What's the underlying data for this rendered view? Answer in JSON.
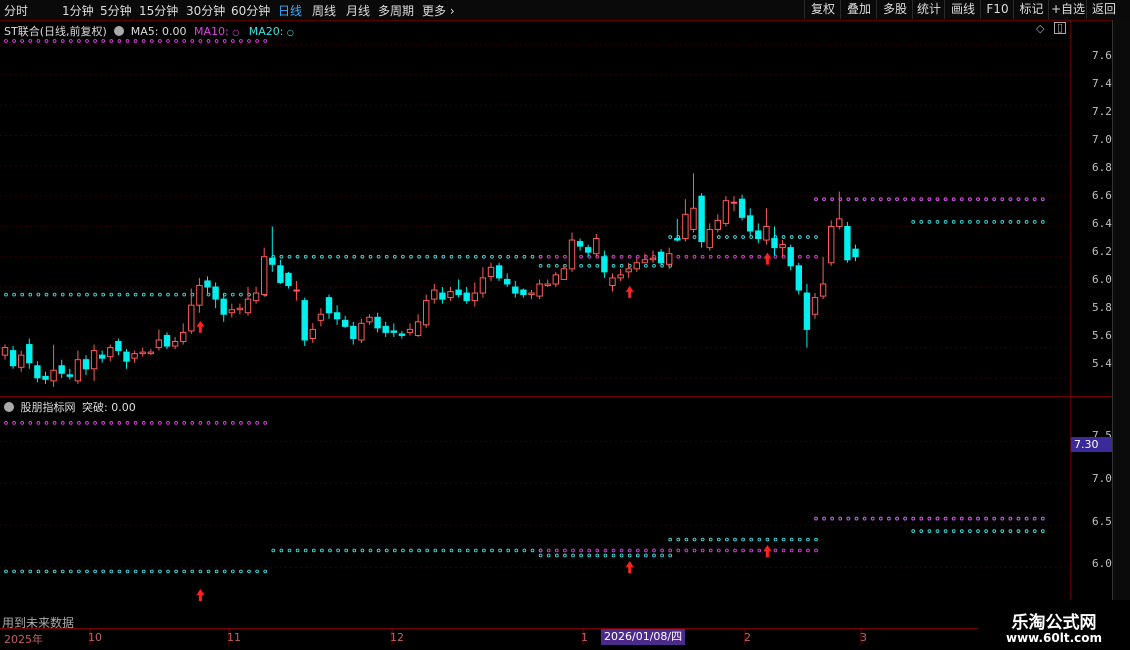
{
  "toolbar": {
    "periods": [
      "分时",
      "1分钟",
      "5分钟",
      "15分钟",
      "30分钟",
      "60分钟",
      "日线",
      "周线",
      "月线",
      "多周期",
      "更多"
    ],
    "active_period": "日线",
    "right_buttons": [
      "复权",
      "叠加",
      "多股",
      "统计",
      "画线",
      "F10",
      "标记",
      "+自选",
      "返回"
    ]
  },
  "main_panel": {
    "title": "ST联合(日线,前复权)",
    "ma5": "MA5: 0.00",
    "ma10": "MA10:",
    "ma20": "MA20:",
    "price_axis": [
      "7.60",
      "7.40",
      "7.20",
      "7.00",
      "6.80",
      "6.60",
      "6.40",
      "6.20",
      "6.00",
      "5.80",
      "5.60",
      "5.40"
    ]
  },
  "sub_panel": {
    "title": "股朋指标网",
    "value": "突破: 0.00",
    "axis": [
      "7.50",
      "7.00",
      "6.50",
      "6.00"
    ],
    "price_tag": "7.30",
    "note": "用到未来数据"
  },
  "x_axis": {
    "labels": [
      "2025年",
      "10",
      "11",
      "12",
      "1",
      "2",
      "3"
    ],
    "cursor_date": "2026/01/08/四"
  },
  "watermark": {
    "line1": "乐淘公式网",
    "line2": "www.60lt.com"
  },
  "colors": {
    "up": "#ff5a5a",
    "down": "#00f0f0",
    "magenta": "#e040e0",
    "cyan_dot": "#40e0e0",
    "arrow": "#ff2020",
    "grid": "#3a0000"
  },
  "chart_data": {
    "type": "candlestick",
    "price_axis_ylim": [
      5.3,
      7.75
    ],
    "bars": [
      [
        5.55,
        5.6,
        5.62,
        5.52
      ],
      [
        5.58,
        5.48,
        5.61,
        5.46
      ],
      [
        5.47,
        5.55,
        5.58,
        5.44
      ],
      [
        5.62,
        5.5,
        5.66,
        5.46
      ],
      [
        5.48,
        5.4,
        5.51,
        5.37
      ],
      [
        5.41,
        5.39,
        5.44,
        5.36
      ],
      [
        5.38,
        5.45,
        5.62,
        5.34
      ],
      [
        5.48,
        5.43,
        5.52,
        5.4
      ],
      [
        5.42,
        5.41,
        5.46,
        5.39
      ],
      [
        5.38,
        5.52,
        5.58,
        5.36
      ],
      [
        5.52,
        5.46,
        5.55,
        5.42
      ],
      [
        5.46,
        5.58,
        5.62,
        5.38
      ],
      [
        5.55,
        5.53,
        5.58,
        5.5
      ],
      [
        5.54,
        5.6,
        5.62,
        5.51
      ],
      [
        5.64,
        5.58,
        5.66,
        5.55
      ],
      [
        5.57,
        5.51,
        5.59,
        5.46
      ],
      [
        5.53,
        5.56,
        5.58,
        5.5
      ],
      [
        5.56,
        5.57,
        5.6,
        5.54
      ],
      [
        5.56,
        5.57,
        5.59,
        5.55
      ],
      [
        5.6,
        5.65,
        5.72,
        5.58
      ],
      [
        5.68,
        5.61,
        5.7,
        5.59
      ],
      [
        5.61,
        5.64,
        5.67,
        5.59
      ],
      [
        5.64,
        5.7,
        5.76,
        5.62
      ],
      [
        5.71,
        5.88,
        5.99,
        5.69
      ],
      [
        5.88,
        6.01,
        6.06,
        5.83
      ],
      [
        6.04,
        6.0,
        6.07,
        5.96
      ],
      [
        6.0,
        5.92,
        6.03,
        5.86
      ],
      [
        5.92,
        5.82,
        5.96,
        5.77
      ],
      [
        5.83,
        5.85,
        5.89,
        5.8
      ],
      [
        5.85,
        5.86,
        5.89,
        5.82
      ],
      [
        5.83,
        5.92,
        6.0,
        5.81
      ],
      [
        5.91,
        5.96,
        6.0,
        5.89
      ],
      [
        5.95,
        6.2,
        6.26,
        5.94
      ],
      [
        6.19,
        6.15,
        6.4,
        6.1
      ],
      [
        6.14,
        6.03,
        6.18,
        6.02
      ],
      [
        6.09,
        6.01,
        6.1,
        5.99
      ],
      [
        5.98,
        5.98,
        6.04,
        5.91
      ],
      [
        5.91,
        5.65,
        5.93,
        5.61
      ],
      [
        5.66,
        5.72,
        5.76,
        5.63
      ],
      [
        5.78,
        5.82,
        5.86,
        5.74
      ],
      [
        5.93,
        5.83,
        5.95,
        5.79
      ],
      [
        5.83,
        5.79,
        5.88,
        5.75
      ],
      [
        5.78,
        5.74,
        5.81,
        5.73
      ],
      [
        5.74,
        5.66,
        5.77,
        5.62
      ],
      [
        5.65,
        5.76,
        5.79,
        5.63
      ],
      [
        5.77,
        5.8,
        5.82,
        5.75
      ],
      [
        5.8,
        5.73,
        5.83,
        5.7
      ],
      [
        5.74,
        5.7,
        5.77,
        5.67
      ],
      [
        5.71,
        5.7,
        5.76,
        5.67
      ],
      [
        5.69,
        5.68,
        5.71,
        5.66
      ],
      [
        5.7,
        5.72,
        5.76,
        5.68
      ],
      [
        5.68,
        5.77,
        5.82,
        5.67
      ],
      [
        5.75,
        5.91,
        5.95,
        5.73
      ],
      [
        5.92,
        5.98,
        6.02,
        5.89
      ],
      [
        5.96,
        5.92,
        6.0,
        5.89
      ],
      [
        5.93,
        5.97,
        6.0,
        5.91
      ],
      [
        5.98,
        5.95,
        6.05,
        5.93
      ],
      [
        5.96,
        5.91,
        6.0,
        5.89
      ],
      [
        5.91,
        5.96,
        6.03,
        5.87
      ],
      [
        5.96,
        6.06,
        6.13,
        5.93
      ],
      [
        6.07,
        6.13,
        6.16,
        6.04
      ],
      [
        6.14,
        6.06,
        6.16,
        6.04
      ],
      [
        6.05,
        6.02,
        6.09,
        6.0
      ],
      [
        6.0,
        5.96,
        6.04,
        5.93
      ],
      [
        5.98,
        5.95,
        5.99,
        5.93
      ],
      [
        5.95,
        5.96,
        5.98,
        5.92
      ],
      [
        5.94,
        6.02,
        6.05,
        5.92
      ],
      [
        6.01,
        6.02,
        6.05,
        6.0
      ],
      [
        6.02,
        6.08,
        6.1,
        6.0
      ],
      [
        6.05,
        6.12,
        6.15,
        6.05
      ],
      [
        6.12,
        6.31,
        6.36,
        6.1
      ],
      [
        6.3,
        6.27,
        6.32,
        6.24
      ],
      [
        6.26,
        6.23,
        6.28,
        6.2
      ],
      [
        6.22,
        6.32,
        6.35,
        6.2
      ],
      [
        6.2,
        6.1,
        6.24,
        6.06
      ],
      [
        6.01,
        6.06,
        6.09,
        5.97
      ],
      [
        6.06,
        6.08,
        6.12,
        6.04
      ],
      [
        6.1,
        6.12,
        6.16,
        6.06
      ],
      [
        6.12,
        6.16,
        6.19,
        6.1
      ],
      [
        6.16,
        6.18,
        6.22,
        6.16
      ],
      [
        6.18,
        6.19,
        6.24,
        6.16
      ],
      [
        6.23,
        6.16,
        6.25,
        6.14
      ],
      [
        6.15,
        6.22,
        6.26,
        6.12
      ],
      [
        6.32,
        6.31,
        6.45,
        6.3
      ],
      [
        6.32,
        6.48,
        6.58,
        6.3
      ],
      [
        6.38,
        6.52,
        6.75,
        6.36
      ],
      [
        6.6,
        6.3,
        6.62,
        6.26
      ],
      [
        6.26,
        6.38,
        6.42,
        6.24
      ],
      [
        6.38,
        6.44,
        6.48,
        6.36
      ],
      [
        6.42,
        6.57,
        6.6,
        6.4
      ],
      [
        6.56,
        6.56,
        6.6,
        6.5
      ],
      [
        6.58,
        6.46,
        6.61,
        6.44
      ],
      [
        6.47,
        6.37,
        6.52,
        6.34
      ],
      [
        6.37,
        6.32,
        6.42,
        6.29
      ],
      [
        6.31,
        6.4,
        6.52,
        6.28
      ],
      [
        6.32,
        6.26,
        6.4,
        6.21
      ],
      [
        6.26,
        6.28,
        6.31,
        6.2
      ],
      [
        6.26,
        6.14,
        6.28,
        6.11
      ],
      [
        6.14,
        5.98,
        6.16,
        5.95
      ],
      [
        5.96,
        5.72,
        6.02,
        5.6
      ],
      [
        5.82,
        5.93,
        5.96,
        5.79
      ],
      [
        5.94,
        6.02,
        6.2,
        5.92
      ],
      [
        6.16,
        6.4,
        6.44,
        6.14
      ],
      [
        6.4,
        6.45,
        6.63,
        6.38
      ],
      [
        6.4,
        6.18,
        6.43,
        6.16
      ],
      [
        6.25,
        6.2,
        6.28,
        6.17
      ]
    ],
    "ma10_level_segments": [
      {
        "from_index": 0,
        "to_index": 32,
        "level": 7.72
      },
      {
        "from_index": 66,
        "to_index": 100,
        "level": 6.2
      },
      {
        "from_index": 100,
        "to_index": 128,
        "level": 6.58
      }
    ],
    "ma20_level_segments": [
      {
        "from_index": 0,
        "to_index": 32,
        "level": 5.95
      },
      {
        "from_index": 33,
        "to_index": 66,
        "level": 6.2
      },
      {
        "from_index": 66,
        "to_index": 82,
        "level": 6.14
      },
      {
        "from_index": 82,
        "to_index": 100,
        "level": 6.33
      },
      {
        "from_index": 100,
        "to_index": 128,
        "level": 6.58
      },
      {
        "from_index": 112,
        "to_index": 128,
        "level": 6.43
      }
    ],
    "signal_arrows": [
      24,
      77,
      94
    ],
    "sub_axis_ylim": [
      5.55,
      7.85
    ],
    "sub_ma10_level_segments": [
      {
        "from_index": 0,
        "to_index": 32,
        "level": 7.72
      },
      {
        "from_index": 66,
        "to_index": 100,
        "level": 6.2
      },
      {
        "from_index": 100,
        "to_index": 128,
        "level": 6.58
      }
    ],
    "sub_ma20_level_segments": [
      {
        "from_index": 0,
        "to_index": 32,
        "level": 5.95
      },
      {
        "from_index": 33,
        "to_index": 66,
        "level": 6.2
      },
      {
        "from_index": 66,
        "to_index": 82,
        "level": 6.14
      },
      {
        "from_index": 82,
        "to_index": 100,
        "level": 6.33
      },
      {
        "from_index": 100,
        "to_index": 128,
        "level": 6.58
      },
      {
        "from_index": 112,
        "to_index": 128,
        "level": 6.43
      }
    ]
  }
}
